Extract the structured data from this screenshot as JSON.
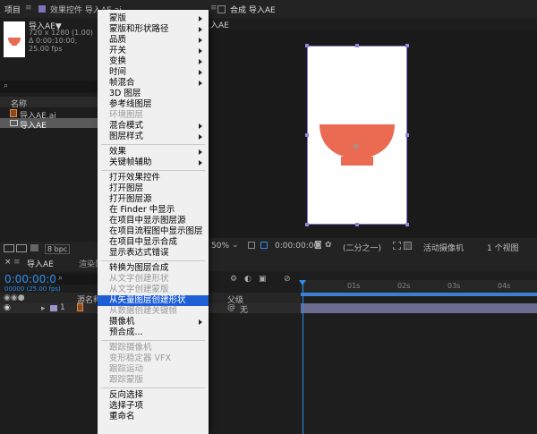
{
  "project_panel": {
    "tab_label": "项目",
    "effects_tab": "效果控件 导入AE.ai",
    "asset_name": "导入AE▼",
    "asset_info_1": "720 x 1280 (1.00)",
    "asset_info_2": "Δ 0:00:10:00, 25.00 fps",
    "search_placeholder": "",
    "column_name": "名称",
    "items": [
      "导入AE.ai",
      "导入AE"
    ],
    "bpc": "8 bpc"
  },
  "composition_panel": {
    "tab_label": "合成 导入AE",
    "sub_tab": "入AE",
    "zoom": "50%",
    "timecode": "0:00:00:00",
    "resolution": "(二分之一)",
    "camera": "活动摄像机",
    "views": "1 个视图"
  },
  "timeline": {
    "tab_label": "导入AE",
    "render_tab": "渲染队",
    "timecode": "0:00:00:00",
    "fps": "00000 (25.00 fps)",
    "col_source": "源名称",
    "col_parent": "父级",
    "layer_index": "1",
    "parent_value": "无",
    "ruler_ticks": [
      "01s",
      "02s",
      "03s",
      "04s"
    ],
    "colors": {
      "timeline_blue": "#2d8ceb",
      "layer_bar": "#6b6b8f"
    }
  },
  "artwork": {
    "bowl_color": "#ea6a52",
    "canvas_color": "#ffffff"
  },
  "context_menu": {
    "items": [
      {
        "label": "蒙版",
        "submenu": true,
        "disabled": false
      },
      {
        "label": "蒙版和形状路径",
        "submenu": true,
        "disabled": false
      },
      {
        "label": "品质",
        "submenu": true,
        "disabled": false
      },
      {
        "label": "开关",
        "submenu": true,
        "disabled": false
      },
      {
        "label": "变换",
        "submenu": true,
        "disabled": false
      },
      {
        "label": "时间",
        "submenu": true,
        "disabled": false
      },
      {
        "label": "帧混合",
        "submenu": true,
        "disabled": false
      },
      {
        "label": "3D 图层",
        "submenu": false,
        "disabled": false
      },
      {
        "label": "参考线图层",
        "submenu": false,
        "disabled": false
      },
      {
        "label": "环境图层",
        "submenu": false,
        "disabled": true
      },
      {
        "label": "混合模式",
        "submenu": true,
        "disabled": false
      },
      {
        "label": "图层样式",
        "submenu": true,
        "disabled": false
      },
      {
        "separator": true
      },
      {
        "label": "效果",
        "submenu": true,
        "disabled": false
      },
      {
        "label": "关键帧辅助",
        "submenu": true,
        "disabled": false
      },
      {
        "separator": true
      },
      {
        "label": "打开效果控件",
        "submenu": false,
        "disabled": false
      },
      {
        "label": "打开图层",
        "submenu": false,
        "disabled": false
      },
      {
        "label": "打开图层源",
        "submenu": false,
        "disabled": false
      },
      {
        "label": "在 Finder 中显示",
        "submenu": false,
        "disabled": false
      },
      {
        "label": "在项目中显示图层源",
        "submenu": false,
        "disabled": false
      },
      {
        "label": "在项目流程图中显示图层",
        "submenu": false,
        "disabled": false
      },
      {
        "label": "在项目中显示合成",
        "submenu": false,
        "disabled": false
      },
      {
        "label": "显示表达式错误",
        "submenu": false,
        "disabled": false
      },
      {
        "separator": true
      },
      {
        "label": "转换为图层合成",
        "submenu": false,
        "disabled": false
      },
      {
        "label": "从文字创建形状",
        "submenu": false,
        "disabled": true
      },
      {
        "label": "从文字创建蒙版",
        "submenu": false,
        "disabled": true
      },
      {
        "label": "从矢量图层创建形状",
        "submenu": false,
        "disabled": false,
        "highlighted": true
      },
      {
        "label": "从数据创建关键帧",
        "submenu": false,
        "disabled": true
      },
      {
        "label": "摄像机",
        "submenu": true,
        "disabled": false
      },
      {
        "label": "预合成...",
        "submenu": false,
        "disabled": false
      },
      {
        "separator": true
      },
      {
        "label": "跟踪摄像机",
        "submenu": false,
        "disabled": true
      },
      {
        "label": "变形稳定器 VFX",
        "submenu": false,
        "disabled": true
      },
      {
        "label": "跟踪运动",
        "submenu": false,
        "disabled": true
      },
      {
        "label": "跟踪蒙版",
        "submenu": false,
        "disabled": true
      },
      {
        "separator": true
      },
      {
        "label": "反向选择",
        "submenu": false,
        "disabled": false
      },
      {
        "label": "选择子项",
        "submenu": false,
        "disabled": false
      },
      {
        "label": "重命名",
        "submenu": false,
        "disabled": false
      }
    ]
  }
}
